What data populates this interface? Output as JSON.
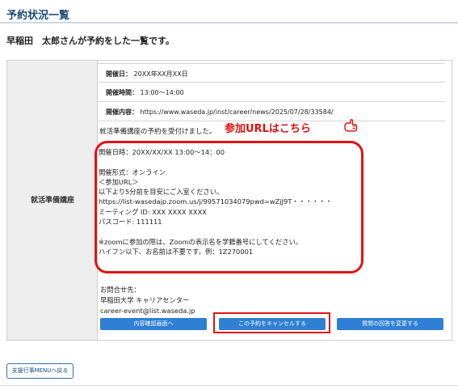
{
  "page": {
    "title": "予約状況一覧",
    "lead": "早稲田　太郎さんが予約をした一覧です。"
  },
  "event": {
    "category_label": "就活準備講座",
    "info": [
      {
        "key": "開催日：",
        "value": "20XX年XX月XX日"
      },
      {
        "key": "開催時間：",
        "value": "13:00〜14:00"
      },
      {
        "key": "開催内容：",
        "value": "https://www.waseda.jp/inst/career/news/2025/07/28/33584/"
      }
    ],
    "accept_text": "就活準備講座の予約を受付けました。",
    "details": "開催日時：20XX/XX/XX 13:00〜14：00\n\n開催形式：オンライン\n＜参加URL＞\n以下より5分前を目安にご入室ください。\nhttps://list-wasedajp.zoom.us/j/99571034079pwd=wZjJ9T・・・・・・\nミーティング ID: XXX XXXX XXXX\nパスコード: 111111\n\n※zoomに参加の際は、Zoomの表示名を学籍番号にしてください。\nハイフン以下、お名前は不要です。例：1Z270001",
    "contact": "お問合せ先：\n早稲田大学 キャリアセンター\ncareer-event@list.waseda.jp"
  },
  "annotation": {
    "join_url": "参加URLはこちら",
    "hand_icon": "pointing-hand-icon",
    "highlight_color": "#e21313"
  },
  "actions": {
    "confirm": "内容確認画面へ",
    "cancel": "この予約をキャンセルする",
    "change": "質問の回答を変更する",
    "back_menu": "支援行事MENUへ戻る"
  },
  "colors": {
    "title": "#1a4a7a",
    "button": "#2f7fd4",
    "annotation": "#e01010"
  }
}
